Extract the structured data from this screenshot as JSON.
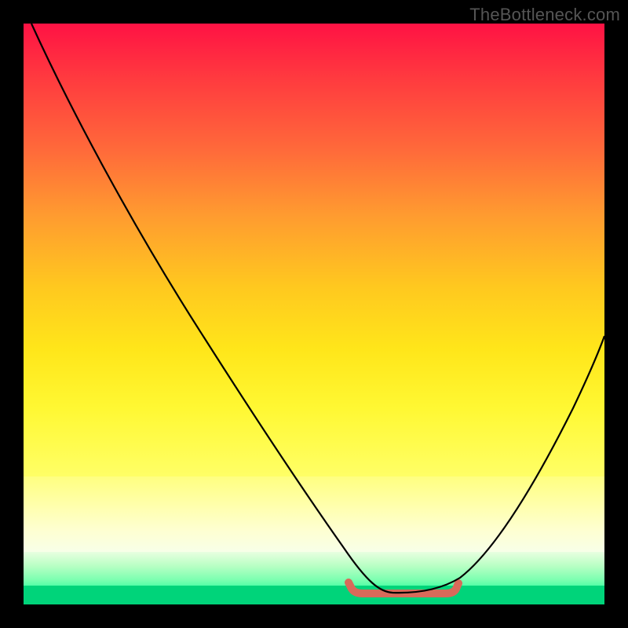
{
  "watermark": "TheBottleneck.com",
  "chart_data": {
    "type": "line",
    "title": "",
    "xlabel": "",
    "ylabel": "",
    "xlim": [
      0,
      100
    ],
    "ylim": [
      0,
      100
    ],
    "background": {
      "kind": "vertical-gradient",
      "stops": [
        {
          "pos": 0.0,
          "color": "#ff1244"
        },
        {
          "pos": 0.4,
          "color": "#ff9a30"
        },
        {
          "pos": 0.7,
          "color": "#ffe61a"
        },
        {
          "pos": 0.88,
          "color": "#ffffb0"
        },
        {
          "pos": 0.95,
          "color": "#9affc0"
        },
        {
          "pos": 1.0,
          "color": "#00d47a"
        }
      ]
    },
    "series": [
      {
        "name": "bottleneck-curve",
        "color": "#000000",
        "x": [
          1,
          10,
          20,
          30,
          40,
          50,
          56,
          60,
          64,
          68,
          74,
          80,
          88,
          95,
          100
        ],
        "y": [
          100,
          86,
          70,
          55,
          39,
          23,
          13,
          7,
          2,
          2,
          2,
          10,
          24,
          38,
          48
        ]
      }
    ],
    "annotations": [
      {
        "name": "optimal-range-marker",
        "color": "#d86a5a",
        "shape": "rounded-u",
        "x_range": [
          56,
          74
        ],
        "y": 2
      }
    ]
  }
}
